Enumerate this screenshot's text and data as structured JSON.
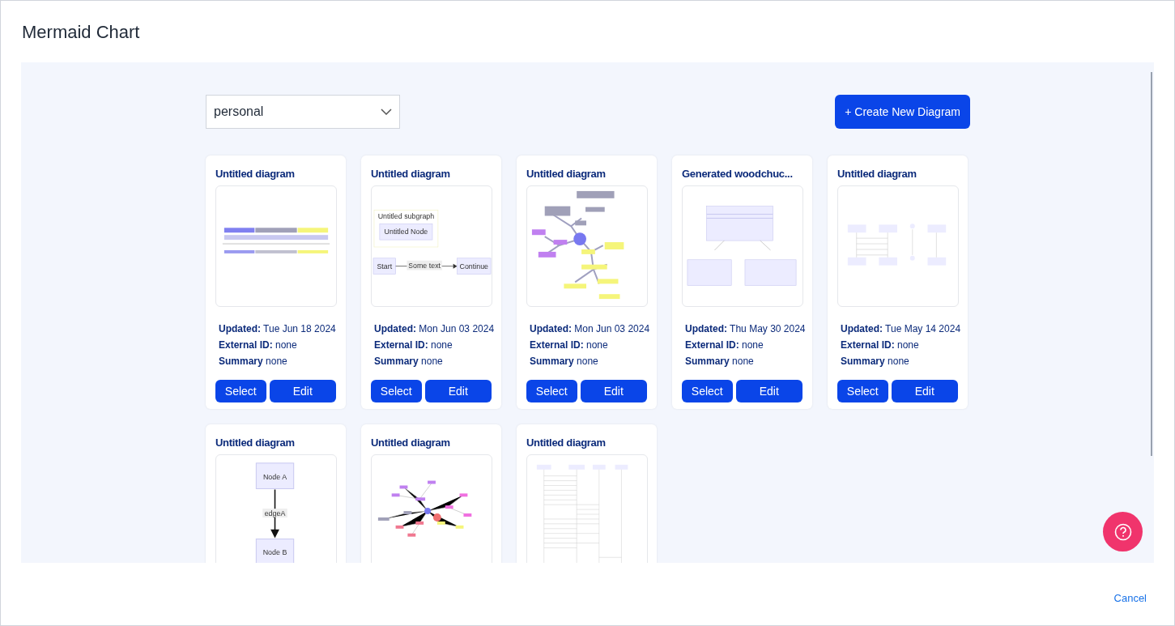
{
  "window": {
    "title": "Mermaid Chart"
  },
  "workspace_select": {
    "value": "personal"
  },
  "create_button": {
    "label": "+ Create New Diagram"
  },
  "diagrams": [
    {
      "title": "Untitled diagram",
      "preview": {
        "kind": "table"
      },
      "updated_label": "Updated:",
      "updated": "Tue Jun 18 2024",
      "external_id_label": "External ID:",
      "external_id": "none",
      "summary_label": "Summary",
      "summary": "none",
      "select_label": "Select",
      "edit_label": "Edit"
    },
    {
      "title": "Untitled diagram",
      "preview": {
        "kind": "flowchart",
        "labels": [
          "Untitled subgraph",
          "Untitled Node",
          "Start",
          "Some text",
          "Continue"
        ]
      },
      "updated_label": "Updated:",
      "updated": "Mon Jun 03 2024",
      "external_id_label": "External ID:",
      "external_id": "none",
      "summary_label": "Summary",
      "summary": "none",
      "select_label": "Select",
      "edit_label": "Edit"
    },
    {
      "title": "Untitled diagram",
      "preview": {
        "kind": "mindmap"
      },
      "updated_label": "Updated:",
      "updated": "Mon Jun 03 2024",
      "external_id_label": "External ID:",
      "external_id": "none",
      "summary_label": "Summary",
      "summary": "none",
      "select_label": "Select",
      "edit_label": "Edit"
    },
    {
      "title": "Generated woodchuc...",
      "preview": {
        "kind": "class"
      },
      "updated_label": "Updated:",
      "updated": "Thu May 30 2024",
      "external_id_label": "External ID:",
      "external_id": "none",
      "summary_label": "Summary",
      "summary": "none",
      "select_label": "Select",
      "edit_label": "Edit"
    },
    {
      "title": "Untitled diagram",
      "preview": {
        "kind": "sequence"
      },
      "updated_label": "Updated:",
      "updated": "Tue May 14 2024",
      "external_id_label": "External ID:",
      "external_id": "none",
      "summary_label": "Summary",
      "summary": "none",
      "select_label": "Select",
      "edit_label": "Edit"
    },
    {
      "title": "Untitled diagram",
      "preview": {
        "kind": "nodes",
        "labels": [
          "Node A",
          "edgeA",
          "Node B"
        ]
      }
    },
    {
      "title": "Untitled diagram",
      "preview": {
        "kind": "bigmindmap"
      }
    },
    {
      "title": "Untitled diagram",
      "preview": {
        "kind": "longsequence"
      }
    }
  ],
  "cancel_link": {
    "label": "Cancel"
  }
}
